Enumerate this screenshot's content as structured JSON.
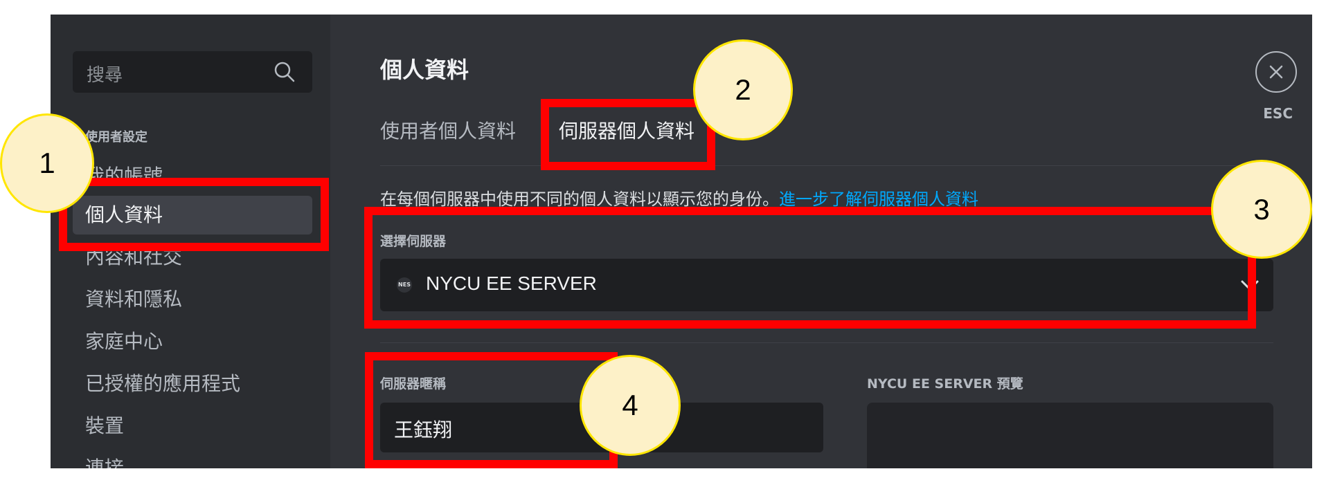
{
  "sidebar": {
    "search_placeholder": "搜尋",
    "section_label": "使用者設定",
    "items": [
      {
        "label": "我的帳號"
      },
      {
        "label": "個人資料"
      },
      {
        "label": "內容和社交"
      },
      {
        "label": "資料和隱私"
      },
      {
        "label": "家庭中心"
      },
      {
        "label": "已授權的應用程式"
      },
      {
        "label": "裝置"
      },
      {
        "label": "連接"
      }
    ],
    "active_item": "個人資料"
  },
  "main": {
    "title": "個人資料",
    "tabs": [
      {
        "label": "使用者個人資料"
      },
      {
        "label": "伺服器個人資料"
      }
    ],
    "active_tab": "伺服器個人資料",
    "description": "在每個伺服器中使用不同的個人資料以顯示您的身份。",
    "learn_more_link": "進一步了解伺服器個人資料",
    "select_server_label": "選擇伺服器",
    "server_icon_text": "NES",
    "selected_server": "NYCU EE SERVER",
    "nickname_label": "伺服器暱稱",
    "nickname_value": "王鈺翔",
    "preview_label": "NYCU EE SERVER 預覽"
  },
  "close": {
    "esc_label": "ESC"
  },
  "annotations": {
    "badges": [
      "1",
      "2",
      "3",
      "4"
    ],
    "highlight_color": "#ff0000",
    "badge_fill": "#fdf1c8",
    "badge_border": "#ffe600"
  },
  "colors": {
    "sidebar_bg": "#2b2d31",
    "main_bg": "#313338",
    "input_bg": "#1e1f22",
    "link": "#00a8fc"
  }
}
